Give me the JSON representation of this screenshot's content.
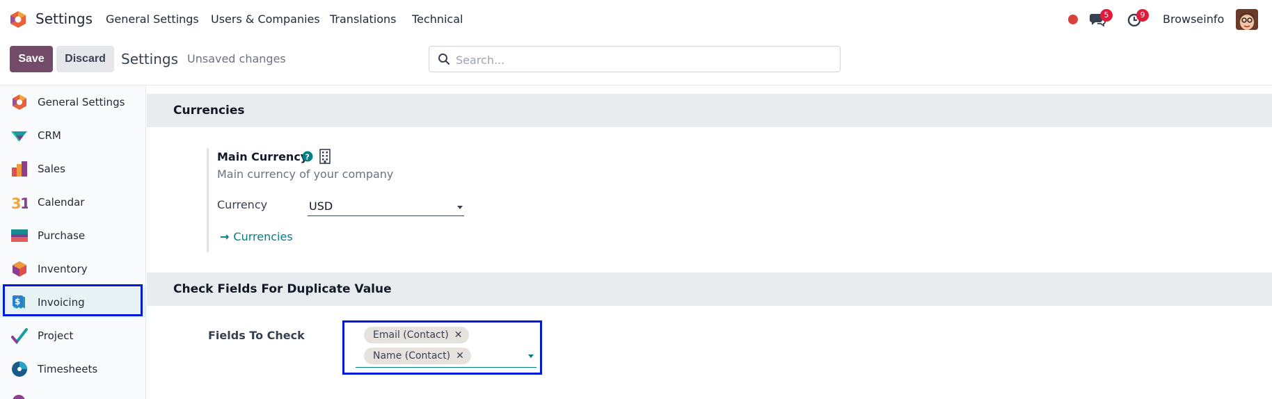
{
  "navbar": {
    "app_name": "Settings",
    "menu": [
      "General Settings",
      "Users & Companies",
      "Translations",
      "Technical"
    ],
    "messages_badge": "5",
    "activities_badge": "9",
    "company": "Browseinfo"
  },
  "control_panel": {
    "save_label": "Save",
    "discard_label": "Discard",
    "breadcrumb": "Settings",
    "status": "Unsaved changes",
    "search_placeholder": "Search..."
  },
  "sidebar": {
    "items": [
      {
        "label": "General Settings",
        "icon": "general-settings-icon"
      },
      {
        "label": "CRM",
        "icon": "crm-icon"
      },
      {
        "label": "Sales",
        "icon": "sales-icon"
      },
      {
        "label": "Calendar",
        "icon": "calendar-icon"
      },
      {
        "label": "Purchase",
        "icon": "purchase-icon"
      },
      {
        "label": "Inventory",
        "icon": "inventory-icon"
      },
      {
        "label": "Invoicing",
        "icon": "invoicing-icon",
        "active": true
      },
      {
        "label": "Project",
        "icon": "project-icon"
      },
      {
        "label": "Timesheets",
        "icon": "timesheets-icon"
      }
    ]
  },
  "currencies_section": {
    "title": "Currencies",
    "setting_title": "Main Currency",
    "setting_desc": "Main currency of your company",
    "currency_label": "Currency",
    "currency_value": "USD",
    "link_label": "Currencies"
  },
  "duplicate_section": {
    "title": "Check Fields For Duplicate Value",
    "fields_label": "Fields To Check",
    "tags": [
      "Email (Contact)",
      "Name (Contact)"
    ]
  },
  "colors": {
    "primary": "#714b67",
    "link": "#017e84",
    "highlight": "#0018d9",
    "badge": "#e01b3c"
  }
}
